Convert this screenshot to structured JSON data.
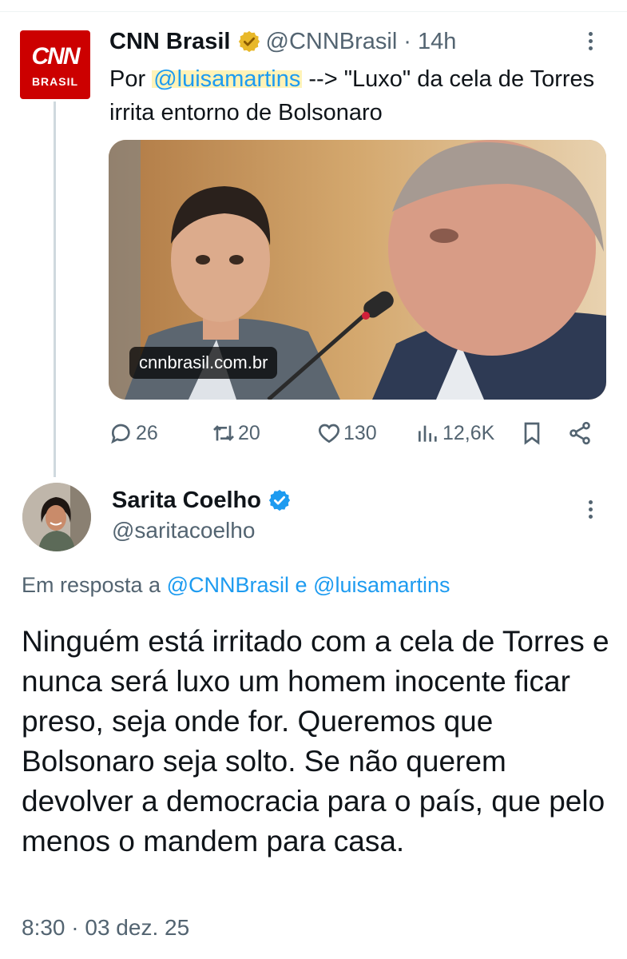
{
  "parent_tweet": {
    "author_name": "CNN Brasil",
    "handle": "@CNNBrasil",
    "separator": "·",
    "time": "14h",
    "avatar": {
      "logo_text": "CNN",
      "subtitle": "BRASIL"
    },
    "verified_badge_icon": "gold-verified-badge-icon",
    "text_prefix": "Por ",
    "text_mention": "@luisamartins",
    "text_rest": " --> \"Luxo\" da cela de Torres irrita entorno de Bolsonaro",
    "link_card": {
      "domain": "cnnbrasil.com.br"
    },
    "actions": {
      "replies": "26",
      "retweets": "20",
      "likes": "130",
      "views": "12,6K"
    }
  },
  "reply_tweet": {
    "author_name": "Sarita Coelho",
    "handle": "@saritacoelho",
    "verified_badge_icon": "blue-verified-badge-icon",
    "reply_to_label": "Em resposta a",
    "reply_to_user1": "@CNNBrasil",
    "reply_to_conjunction": "e",
    "reply_to_user2": "@luisamartins",
    "text": "Ninguém está irritado com a cela de Torres e nunca será luxo um homem inocente ficar preso, seja onde for. Queremos que Bolsonaro seja solto. Se não querem devolver a democracia para o país, que pelo menos o mandem para casa.",
    "timestamp": "8:30 · 03 dez. 25"
  },
  "colors": {
    "link": "#1d9bf0",
    "muted": "#536471",
    "cnn_red": "#cc0000",
    "gold_badge": "#e8b829",
    "highlight": "#fff3b8"
  }
}
